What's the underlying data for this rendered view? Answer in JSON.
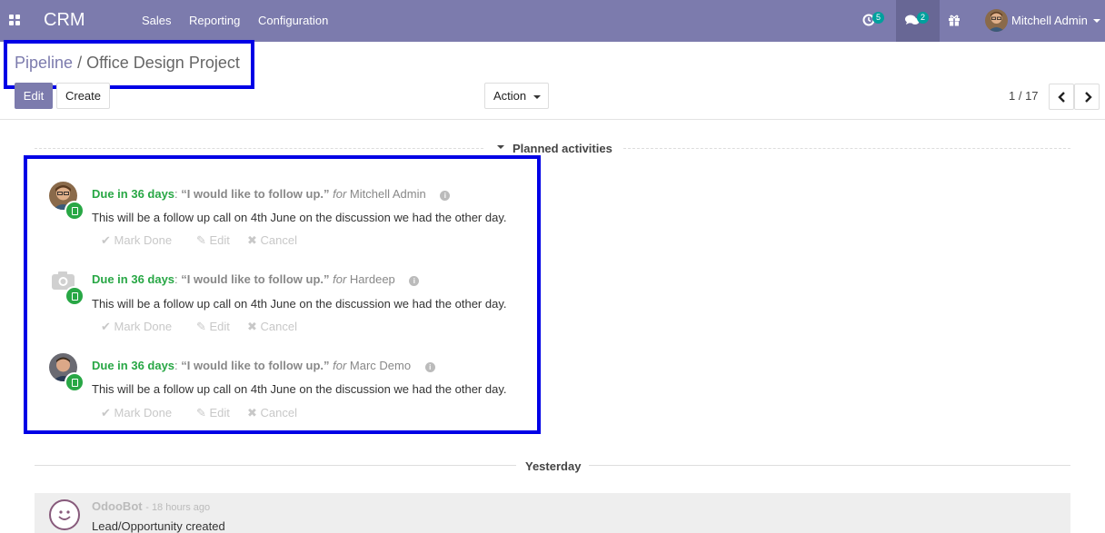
{
  "navbar": {
    "app_name": "CRM",
    "menus": [
      "Sales",
      "Reporting",
      "Configuration"
    ],
    "activity_count": "5",
    "messages_count": "2",
    "user_name": "Mitchell Admin",
    "bg_color": "#7c7bad"
  },
  "breadcrumb": {
    "parent": "Pipeline",
    "separator": "/",
    "current": "Office Design Project"
  },
  "buttons": {
    "edit": "Edit",
    "create": "Create",
    "action": "Action"
  },
  "pager": {
    "value": "1 / 17"
  },
  "planned": {
    "title": "Planned activities",
    "activities": [
      {
        "due": "Due in 36 days",
        "summary": "“I would like to follow up.”",
        "for_label": "for",
        "assignee": "Mitchell Admin",
        "note": "This will be a follow up call on 4th June on the discussion we had the other day.",
        "avatar_icon": "user-photo"
      },
      {
        "due": "Due in 36 days",
        "summary": "“I would like to follow up.”",
        "for_label": "for",
        "assignee": "Hardeep",
        "note": "This will be a follow up call on 4th June on the discussion we had the other day.",
        "avatar_icon": "camera-placeholder-icon"
      },
      {
        "due": "Due in 36 days",
        "summary": "“I would like to follow up.”",
        "for_label": "for",
        "assignee": "Marc Demo",
        "note": "This will be a follow up call on 4th June on the discussion we had the other day.",
        "avatar_icon": "user-photo"
      }
    ],
    "mark_done": "Mark Done",
    "edit": "Edit",
    "cancel": "Cancel",
    "due_color": "#28a745"
  },
  "yesterday": {
    "title": "Yesterday"
  },
  "message": {
    "author": "OdooBot",
    "date": "- 18 hours ago",
    "body": "Lead/Opportunity created"
  },
  "annotation_color": "#0000e6"
}
